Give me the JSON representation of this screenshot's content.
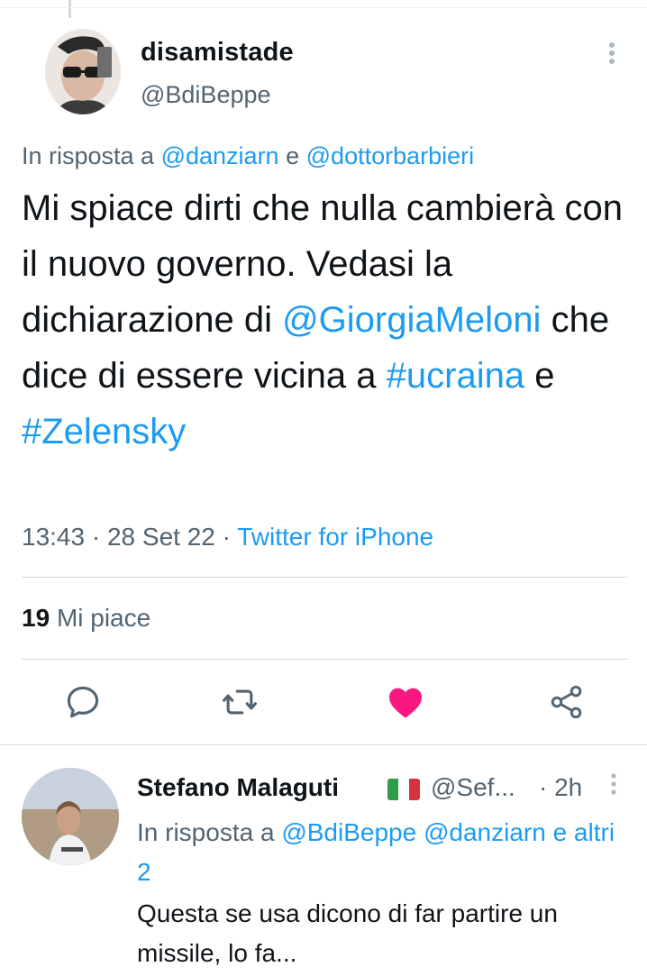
{
  "tweet": {
    "display_name": "disamistade",
    "handle": "@BdiBeppe",
    "reply_prefix": "In risposta a",
    "reply_user1": "@danziarn",
    "reply_and": "e",
    "reply_user2": "@dottorbarbieri",
    "text_part1": "Mi spiace dirti che nulla cambierà con il nuovo governo. Vedasi la dichiarazione di ",
    "mention": "@GiorgiaMeloni",
    "text_part2": " che dice di essere vicina a ",
    "hashtag1": "#ucraina",
    "text_part3": " e ",
    "hashtag2": "#Zelensky",
    "time": "13:43",
    "sep1": " · ",
    "date": "28 Set 22",
    "sep2": " · ",
    "source": "Twitter for iPhone",
    "likes_count": "19",
    "likes_label": "Mi piace"
  },
  "actions": {
    "reply_icon": "reply-icon",
    "retweet_icon": "retweet-icon",
    "like_icon": "heart-filled-icon",
    "share_icon": "share-icon",
    "liked": true
  },
  "reply_tweet": {
    "display_name": "Stefano Malaguti",
    "handle": "@Sef...",
    "time": "· 2h",
    "reply_prefix": "In risposta a",
    "reply_user1": "@BdiBeppe",
    "reply_user2": "@danziarn",
    "reply_more": "e altri 2",
    "text": "Questa se usa dicono di far partire un missile, lo fa..."
  },
  "colors": {
    "link": "#1d9bf0",
    "secondary_text": "#536471",
    "like_active": "#f91880",
    "divider": "#cfd9de"
  }
}
